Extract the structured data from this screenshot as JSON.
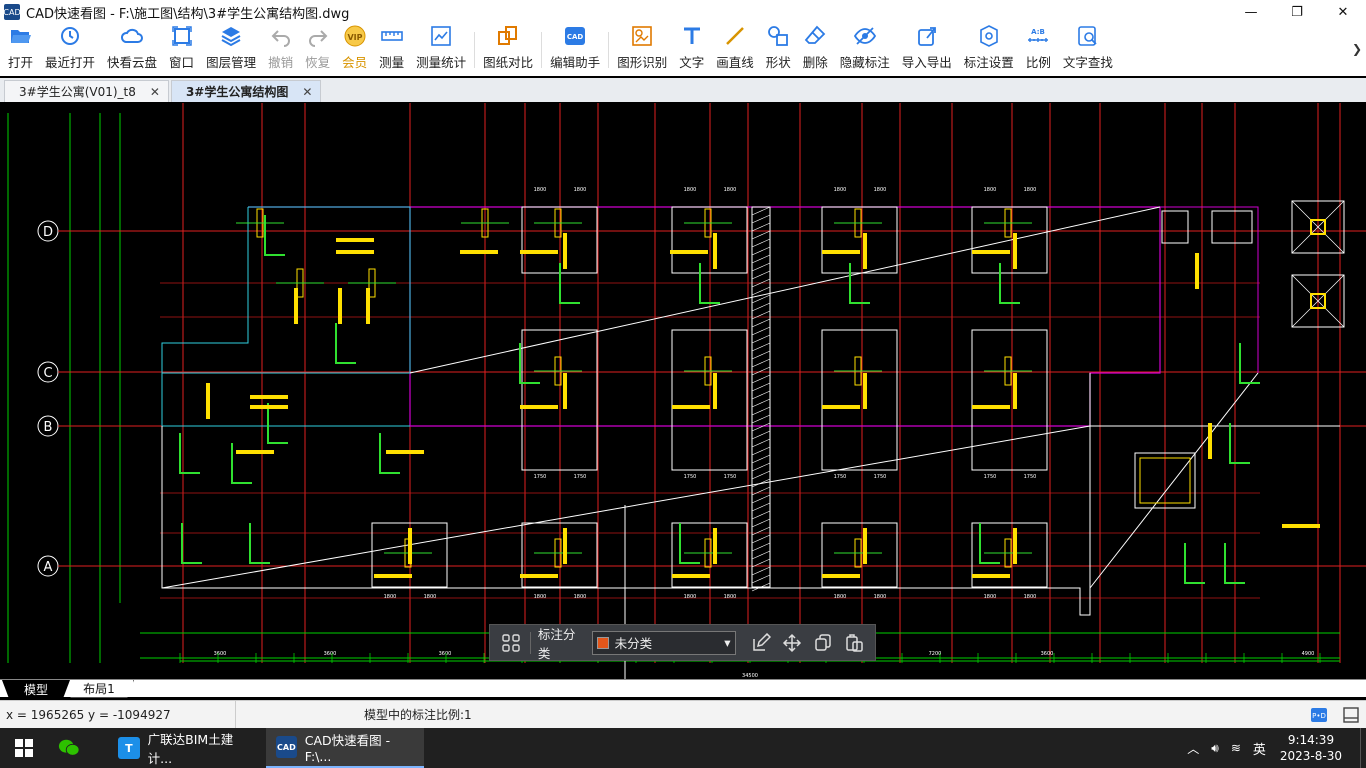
{
  "window": {
    "title": "CAD快速看图 - F:\\施工图\\结构\\3#学生公寓结构图.dwg",
    "logo_text": "CAD"
  },
  "toolbar": [
    {
      "label": "打开",
      "icon": "folder-open-icon"
    },
    {
      "label": "最近打开",
      "icon": "history-icon"
    },
    {
      "label": "快看云盘",
      "icon": "cloud-icon"
    },
    {
      "label": "窗口",
      "icon": "window-icon"
    },
    {
      "label": "图层管理",
      "icon": "layers-icon"
    },
    {
      "label": "撤销",
      "icon": "undo-icon",
      "disabled": true
    },
    {
      "label": "恢复",
      "icon": "redo-icon",
      "disabled": true
    },
    {
      "label": "会员",
      "icon": "vip-icon",
      "vip": true
    },
    {
      "label": "测量",
      "icon": "ruler-icon"
    },
    {
      "label": "测量统计",
      "icon": "measure-stats-icon"
    },
    {
      "label": "图纸对比",
      "icon": "compare-icon"
    },
    {
      "label": "编辑助手",
      "icon": "edit-assistant-icon"
    },
    {
      "label": "图形识别",
      "icon": "shape-recognize-icon"
    },
    {
      "label": "文字",
      "icon": "text-icon"
    },
    {
      "label": "画直线",
      "icon": "line-icon"
    },
    {
      "label": "形状",
      "icon": "shape-icon"
    },
    {
      "label": "删除",
      "icon": "eraser-icon"
    },
    {
      "label": "隐藏标注",
      "icon": "hide-icon"
    },
    {
      "label": "导入导出",
      "icon": "import-export-icon"
    },
    {
      "label": "标注设置",
      "icon": "annotation-settings-icon"
    },
    {
      "label": "比例",
      "icon": "scale-icon"
    },
    {
      "label": "文字查找",
      "icon": "text-search-icon"
    }
  ],
  "tabs": [
    {
      "label": "3#学生公寓(V01)_t8",
      "active": false
    },
    {
      "label": "3#学生公寓结构图",
      "active": true
    }
  ],
  "tab_close": "✕",
  "drawing": {
    "axes": [
      "D",
      "C",
      "B",
      "A"
    ],
    "dim_bottom": [
      "3600",
      "3600",
      "3600",
      "7200",
      "3600",
      "4900"
    ],
    "total_length": "34500"
  },
  "floatbar": {
    "label": "标注分类",
    "selected": "未分类",
    "swatch_color": "#e2561b"
  },
  "layout_tabs": [
    "模型",
    "布局1"
  ],
  "status": {
    "coords": "x = 1965265  y = -1094927",
    "scale": "模型中的标注比例:1"
  },
  "taskbar": {
    "apps": [
      {
        "label": "",
        "icon": "wechat-icon",
        "color": "#2dc100"
      },
      {
        "label": "广联达BIM土建计...",
        "icon": "glodon-icon",
        "color": "#1c8fe8"
      },
      {
        "label": "CAD快速看图 - F:\\...",
        "icon": "cad-icon",
        "color": "#1a4a8a",
        "active": true
      }
    ],
    "ime": "英",
    "time": "9:14:39",
    "date": "2023-8-30"
  }
}
